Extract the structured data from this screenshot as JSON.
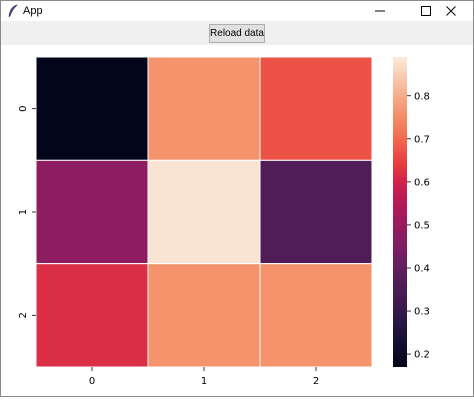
{
  "window": {
    "title": "App"
  },
  "toolbar": {
    "reload_label": "Reload data"
  },
  "icons": {
    "app": "feather-icon",
    "minimize": "minimize-icon",
    "maximize": "maximize-icon",
    "close": "close-icon"
  },
  "chart_data": {
    "type": "heatmap",
    "title": "",
    "xlabel": "",
    "ylabel": "",
    "x_categories": [
      "0",
      "1",
      "2"
    ],
    "y_categories": [
      "0",
      "1",
      "2"
    ],
    "values": [
      [
        0.17,
        0.76,
        0.67
      ],
      [
        0.48,
        0.88,
        0.36
      ],
      [
        0.62,
        0.76,
        0.76
      ]
    ],
    "colorbar": {
      "min": 0.17,
      "max": 0.89,
      "ticks": [
        0.2,
        0.3,
        0.4,
        0.5,
        0.6,
        0.7,
        0.8
      ],
      "tick_labels": [
        "0.2",
        "0.3",
        "0.4",
        "0.5",
        "0.6",
        "0.7",
        "0.8"
      ],
      "colormap": "rocket"
    },
    "grid": false
  }
}
